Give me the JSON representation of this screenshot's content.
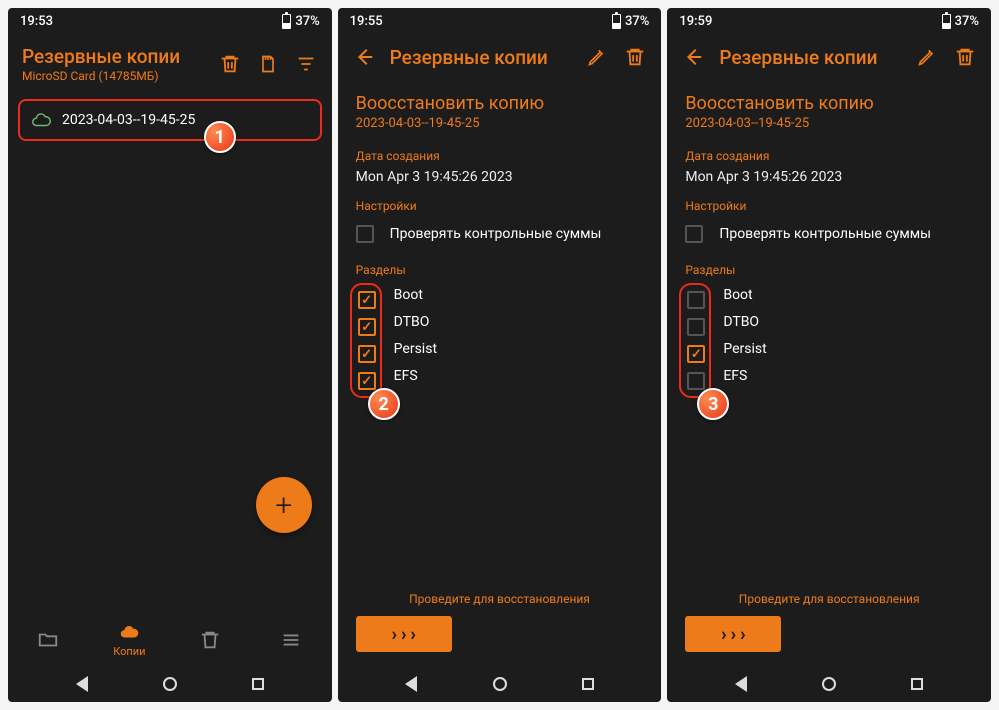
{
  "colors": {
    "accent": "#ee7b1a",
    "highlight": "#ee2a1a",
    "bg": "#1d1c1c"
  },
  "screen1": {
    "time": "19:53",
    "battery": "37%",
    "title": "Резервные копии",
    "subtitle": "MicroSD Card (14785МБ)",
    "backup_item": "2023-04-03--19-45-25",
    "nav": {
      "folder": "",
      "copies": "Копии",
      "trash": "",
      "menu": ""
    },
    "step": "1"
  },
  "screen2": {
    "time": "19:55",
    "battery": "37%",
    "header": "Резервные копии",
    "detail_title": "Воосстановить копию",
    "detail_sub": "2023-04-03--19-45-25",
    "date_label": "Дата создания",
    "date_value": "Mon Apr  3 19:45:26 2023",
    "settings_label": "Настройки",
    "checksum_label": "Проверять контрольные суммы",
    "partitions_label": "Разделы",
    "partitions": [
      {
        "name": "Boot",
        "checked": true
      },
      {
        "name": "DTBO",
        "checked": true
      },
      {
        "name": "Persist",
        "checked": true
      },
      {
        "name": "EFS",
        "checked": true
      }
    ],
    "swipe_hint": "Проведите для восстановления",
    "step": "2"
  },
  "screen3": {
    "time": "19:59",
    "battery": "37%",
    "header": "Резервные копии",
    "detail_title": "Воосстановить копию",
    "detail_sub": "2023-04-03--19-45-25",
    "date_label": "Дата создания",
    "date_value": "Mon Apr  3 19:45:26 2023",
    "settings_label": "Настройки",
    "checksum_label": "Проверять контрольные суммы",
    "partitions_label": "Разделы",
    "partitions": [
      {
        "name": "Boot",
        "checked": false
      },
      {
        "name": "DTBO",
        "checked": false
      },
      {
        "name": "Persist",
        "checked": true
      },
      {
        "name": "EFS",
        "checked": false
      }
    ],
    "swipe_hint": "Проведите для восстановления",
    "step": "3"
  }
}
